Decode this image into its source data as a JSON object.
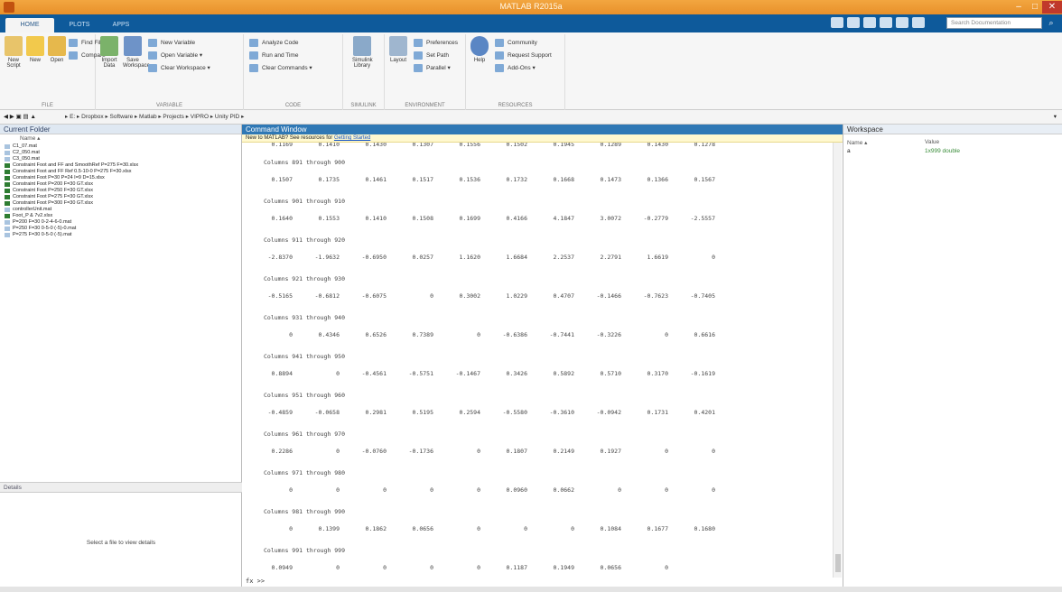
{
  "window": {
    "title": "MATLAB R2015a",
    "min": "–",
    "max": "□",
    "close": "✕"
  },
  "tabs": [
    {
      "label": "HOME"
    },
    {
      "label": "PLOTS"
    },
    {
      "label": "APPS"
    }
  ],
  "search": {
    "placeholder": "Search Documentation",
    "icon": "search-icon"
  },
  "ribbon": {
    "file": {
      "new_script": "New Script",
      "new": "New",
      "open": "Open",
      "find_files": "Find Files",
      "compare": "Compare",
      "group": "FILE"
    },
    "variable": {
      "import_data": "Import Data",
      "save_workspace": "Save Workspace",
      "new_variable": "New Variable",
      "open_variable": "Open Variable ▾",
      "clear_workspace": "Clear Workspace ▾",
      "group": "VARIABLE"
    },
    "code": {
      "analyze_code": "Analyze Code",
      "run_and_time": "Run and Time",
      "clear_commands": "Clear Commands ▾",
      "group": "CODE"
    },
    "simulink": {
      "library": "Simulink Library",
      "group": "SIMULINK"
    },
    "environment": {
      "layout": "Layout",
      "preferences": "Preferences",
      "set_path": "Set Path",
      "parallel": "Parallel ▾",
      "group": "ENVIRONMENT"
    },
    "resources": {
      "help": "Help",
      "community": "Community",
      "request_support": "Request Support",
      "add_ons": "Add-Ons ▾",
      "group": "RESOURCES"
    }
  },
  "path": {
    "crumbs": "▸ E: ▸ Dropbox ▸ Software ▸ Matlab ▸ Projects ▸ VIPRO ▸ Unity PID ▸"
  },
  "current_folder": {
    "title": "Current Folder",
    "name_col": "Name ▴",
    "files": [
      {
        "name": "C1_07.mat",
        "type": "mat"
      },
      {
        "name": "C2_050.mat",
        "type": "mat"
      },
      {
        "name": "C3_050.mat",
        "type": "mat"
      },
      {
        "name": "Constraint Foot and FF and SmoothRef P=275 F=30.xlsx",
        "type": "xls"
      },
      {
        "name": "Constraint Foot and FF Ref 0.5-10-0 P=275 F=30.xlsx",
        "type": "xls"
      },
      {
        "name": "Constraint Foot P=30 P=24 I=9 D=15.xlsx",
        "type": "xls"
      },
      {
        "name": "Constraint Foot P=200 F=30 GT.xlsx",
        "type": "xls"
      },
      {
        "name": "Constraint Foot P=250 F=30 GT.xlsx",
        "type": "xls"
      },
      {
        "name": "Constraint Foot P=275 F=30 GT.xlsx",
        "type": "xls"
      },
      {
        "name": "Constraint Foot P=300 F=30 GT.xlsx",
        "type": "xls"
      },
      {
        "name": "controllerUnit.mat",
        "type": "mat"
      },
      {
        "name": "Foot_P & 7v2.xlsx",
        "type": "xls"
      },
      {
        "name": "P=200 F=30 0-2-4-6-0.mat",
        "type": "mat"
      },
      {
        "name": "P=250 F=30 0-5-0 (-5)-0.mat",
        "type": "mat"
      },
      {
        "name": "P=275 F=30 0-5-0 (-5).mat",
        "type": "mat"
      }
    ],
    "details_label": "Details",
    "details_msg": "Select a file to view details"
  },
  "command_window": {
    "title": "Command Window",
    "notice_prefix": "New to MATLAB? See resources for ",
    "notice_link": "Getting Started",
    "top_row": [
      "0.1169",
      "0.1410",
      "0.1430",
      "0.1307",
      "0.1556",
      "0.1502",
      "0.1945",
      "0.1289",
      "0.1430",
      "0.1278"
    ],
    "blocks": [
      {
        "header": "Columns 891 through 900",
        "values": [
          "0.1507",
          "0.1735",
          "0.1461",
          "0.1517",
          "0.1536",
          "0.1732",
          "0.1668",
          "0.1473",
          "0.1366",
          "0.1567"
        ]
      },
      {
        "header": "Columns 901 through 910",
        "values": [
          "0.1640",
          "0.1553",
          "0.1410",
          "0.1508",
          "0.1699",
          "0.4166",
          "4.1847",
          "3.0072",
          "-0.2779",
          "-2.5557"
        ]
      },
      {
        "header": "Columns 911 through 920",
        "values": [
          "-2.8370",
          "-1.9632",
          "-0.6950",
          "0.0257",
          "1.1620",
          "1.6684",
          "2.2537",
          "2.2791",
          "1.6619",
          "0"
        ]
      },
      {
        "header": "Columns 921 through 930",
        "values": [
          "-0.5165",
          "-0.6812",
          "-0.6075",
          "0",
          "0.3002",
          "1.0229",
          "0.4707",
          "-0.1466",
          "-0.7623",
          "-0.7405"
        ]
      },
      {
        "header": "Columns 931 through 940",
        "values": [
          "0",
          "0.4346",
          "0.6526",
          "0.7389",
          "0",
          "-0.6386",
          "-0.7441",
          "-0.3226",
          "0",
          "0.6616"
        ]
      },
      {
        "header": "Columns 941 through 950",
        "values": [
          "0.8894",
          "0",
          "-0.4561",
          "-0.5751",
          "-0.1467",
          "0.3426",
          "0.5892",
          "0.5710",
          "0.3170",
          "-0.1619"
        ]
      },
      {
        "header": "Columns 951 through 960",
        "values": [
          "-0.4859",
          "-0.0658",
          "0.2981",
          "0.5195",
          "0.2594",
          "-0.5580",
          "-0.3610",
          "-0.0942",
          "0.1731",
          "0.4201"
        ]
      },
      {
        "header": "Columns 961 through 970",
        "values": [
          "0.2286",
          "0",
          "-0.0760",
          "-0.1736",
          "0",
          "0.1807",
          "0.2149",
          "0.1927",
          "0",
          "0"
        ]
      },
      {
        "header": "Columns 971 through 980",
        "values": [
          "0",
          "0",
          "0",
          "0",
          "0",
          "0.0960",
          "0.0662",
          "0",
          "0",
          "0"
        ]
      },
      {
        "header": "Columns 981 through 990",
        "values": [
          "0",
          "0.1399",
          "0.1862",
          "0.0656",
          "0",
          "0",
          "0",
          "0.1084",
          "0.1677",
          "0.1680"
        ]
      },
      {
        "header": "Columns 991 through 999",
        "values": [
          "0.0949",
          "0",
          "0",
          "0",
          "0",
          "0.1187",
          "0.1949",
          "0.0656",
          "0"
        ]
      }
    ],
    "prompt": "fx >>"
  },
  "workspace": {
    "title": "Workspace",
    "name_col": "Name ▴",
    "value_col": "Value",
    "variables": [
      {
        "name": "a",
        "value": "1x999 double"
      }
    ]
  }
}
